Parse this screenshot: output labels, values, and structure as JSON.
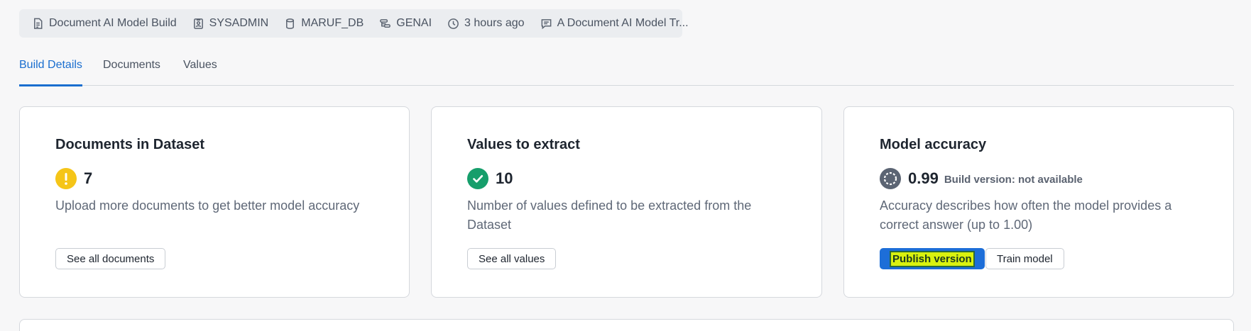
{
  "meta": {
    "items": [
      {
        "icon": "document-icon",
        "label": "Document AI Model Build"
      },
      {
        "icon": "user-badge-icon",
        "label": "SYSADMIN"
      },
      {
        "icon": "database-icon",
        "label": "MARUF_DB"
      },
      {
        "icon": "schema-icon",
        "label": "GENAI"
      },
      {
        "icon": "clock-icon",
        "label": "3 hours ago"
      },
      {
        "icon": "comment-icon",
        "label": "A Document AI Model Tr..."
      }
    ]
  },
  "tabs": [
    {
      "label": "Build Details",
      "active": true
    },
    {
      "label": "Documents",
      "active": false
    },
    {
      "label": "Values",
      "active": false
    }
  ],
  "cards": {
    "documents": {
      "title": "Documents in Dataset",
      "value": "7",
      "status_icon": "warning-icon",
      "status_color": "#f5c518",
      "description": "Upload more documents to get better model accuracy",
      "button": "See all documents"
    },
    "values": {
      "title": "Values to extract",
      "value": "10",
      "status_icon": "check-circle-icon",
      "status_color": "#169e6b",
      "description": "Number of values defined to be extracted from the Dataset",
      "button": "See all values"
    },
    "accuracy": {
      "title": "Model accuracy",
      "value": "0.99",
      "status_icon": "progress-ring-icon",
      "status_color": "#5b6473",
      "subtext": "Build version: not available",
      "description": "Accuracy describes how often the model provides a correct answer (up to 1.00)",
      "primary_button": "Publish version",
      "secondary_button": "Train model"
    }
  },
  "colors": {
    "accent": "#1a6ecf",
    "highlight": "#d9f20e"
  }
}
